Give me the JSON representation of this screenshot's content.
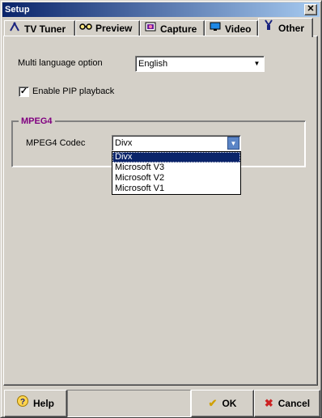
{
  "window": {
    "title": "Setup",
    "close_glyph": "✕"
  },
  "tabs": [
    {
      "label": "TV Tuner",
      "icon": "antenna-icon",
      "active": false
    },
    {
      "label": "Preview",
      "icon": "glasses-icon",
      "active": false
    },
    {
      "label": "Capture",
      "icon": "capture-icon",
      "active": false
    },
    {
      "label": "Video",
      "icon": "monitor-icon",
      "active": false
    },
    {
      "label": "Other",
      "icon": "tools-icon",
      "active": true
    }
  ],
  "settings": {
    "language_label": "Multi language option",
    "language_value": "English",
    "pip_label": "Enable PIP playback",
    "pip_checked": true
  },
  "mpeg4": {
    "group_title": "MPEG4",
    "codec_label": "MPEG4 Codec",
    "codec_value": "Divx",
    "options": [
      "Divx",
      "Microsoft V3",
      "Microsoft V2",
      "Microsoft V1"
    ],
    "selected_index": 0
  },
  "buttons": {
    "help": "Help",
    "ok": "OK",
    "cancel": "Cancel"
  },
  "colors": {
    "group_title": "#800080",
    "selection": "#0a246a",
    "titlebar_start": "#0a246a",
    "titlebar_end": "#a6caf0",
    "ok_icon": "#d0a000",
    "cancel_icon": "#cc2222"
  }
}
